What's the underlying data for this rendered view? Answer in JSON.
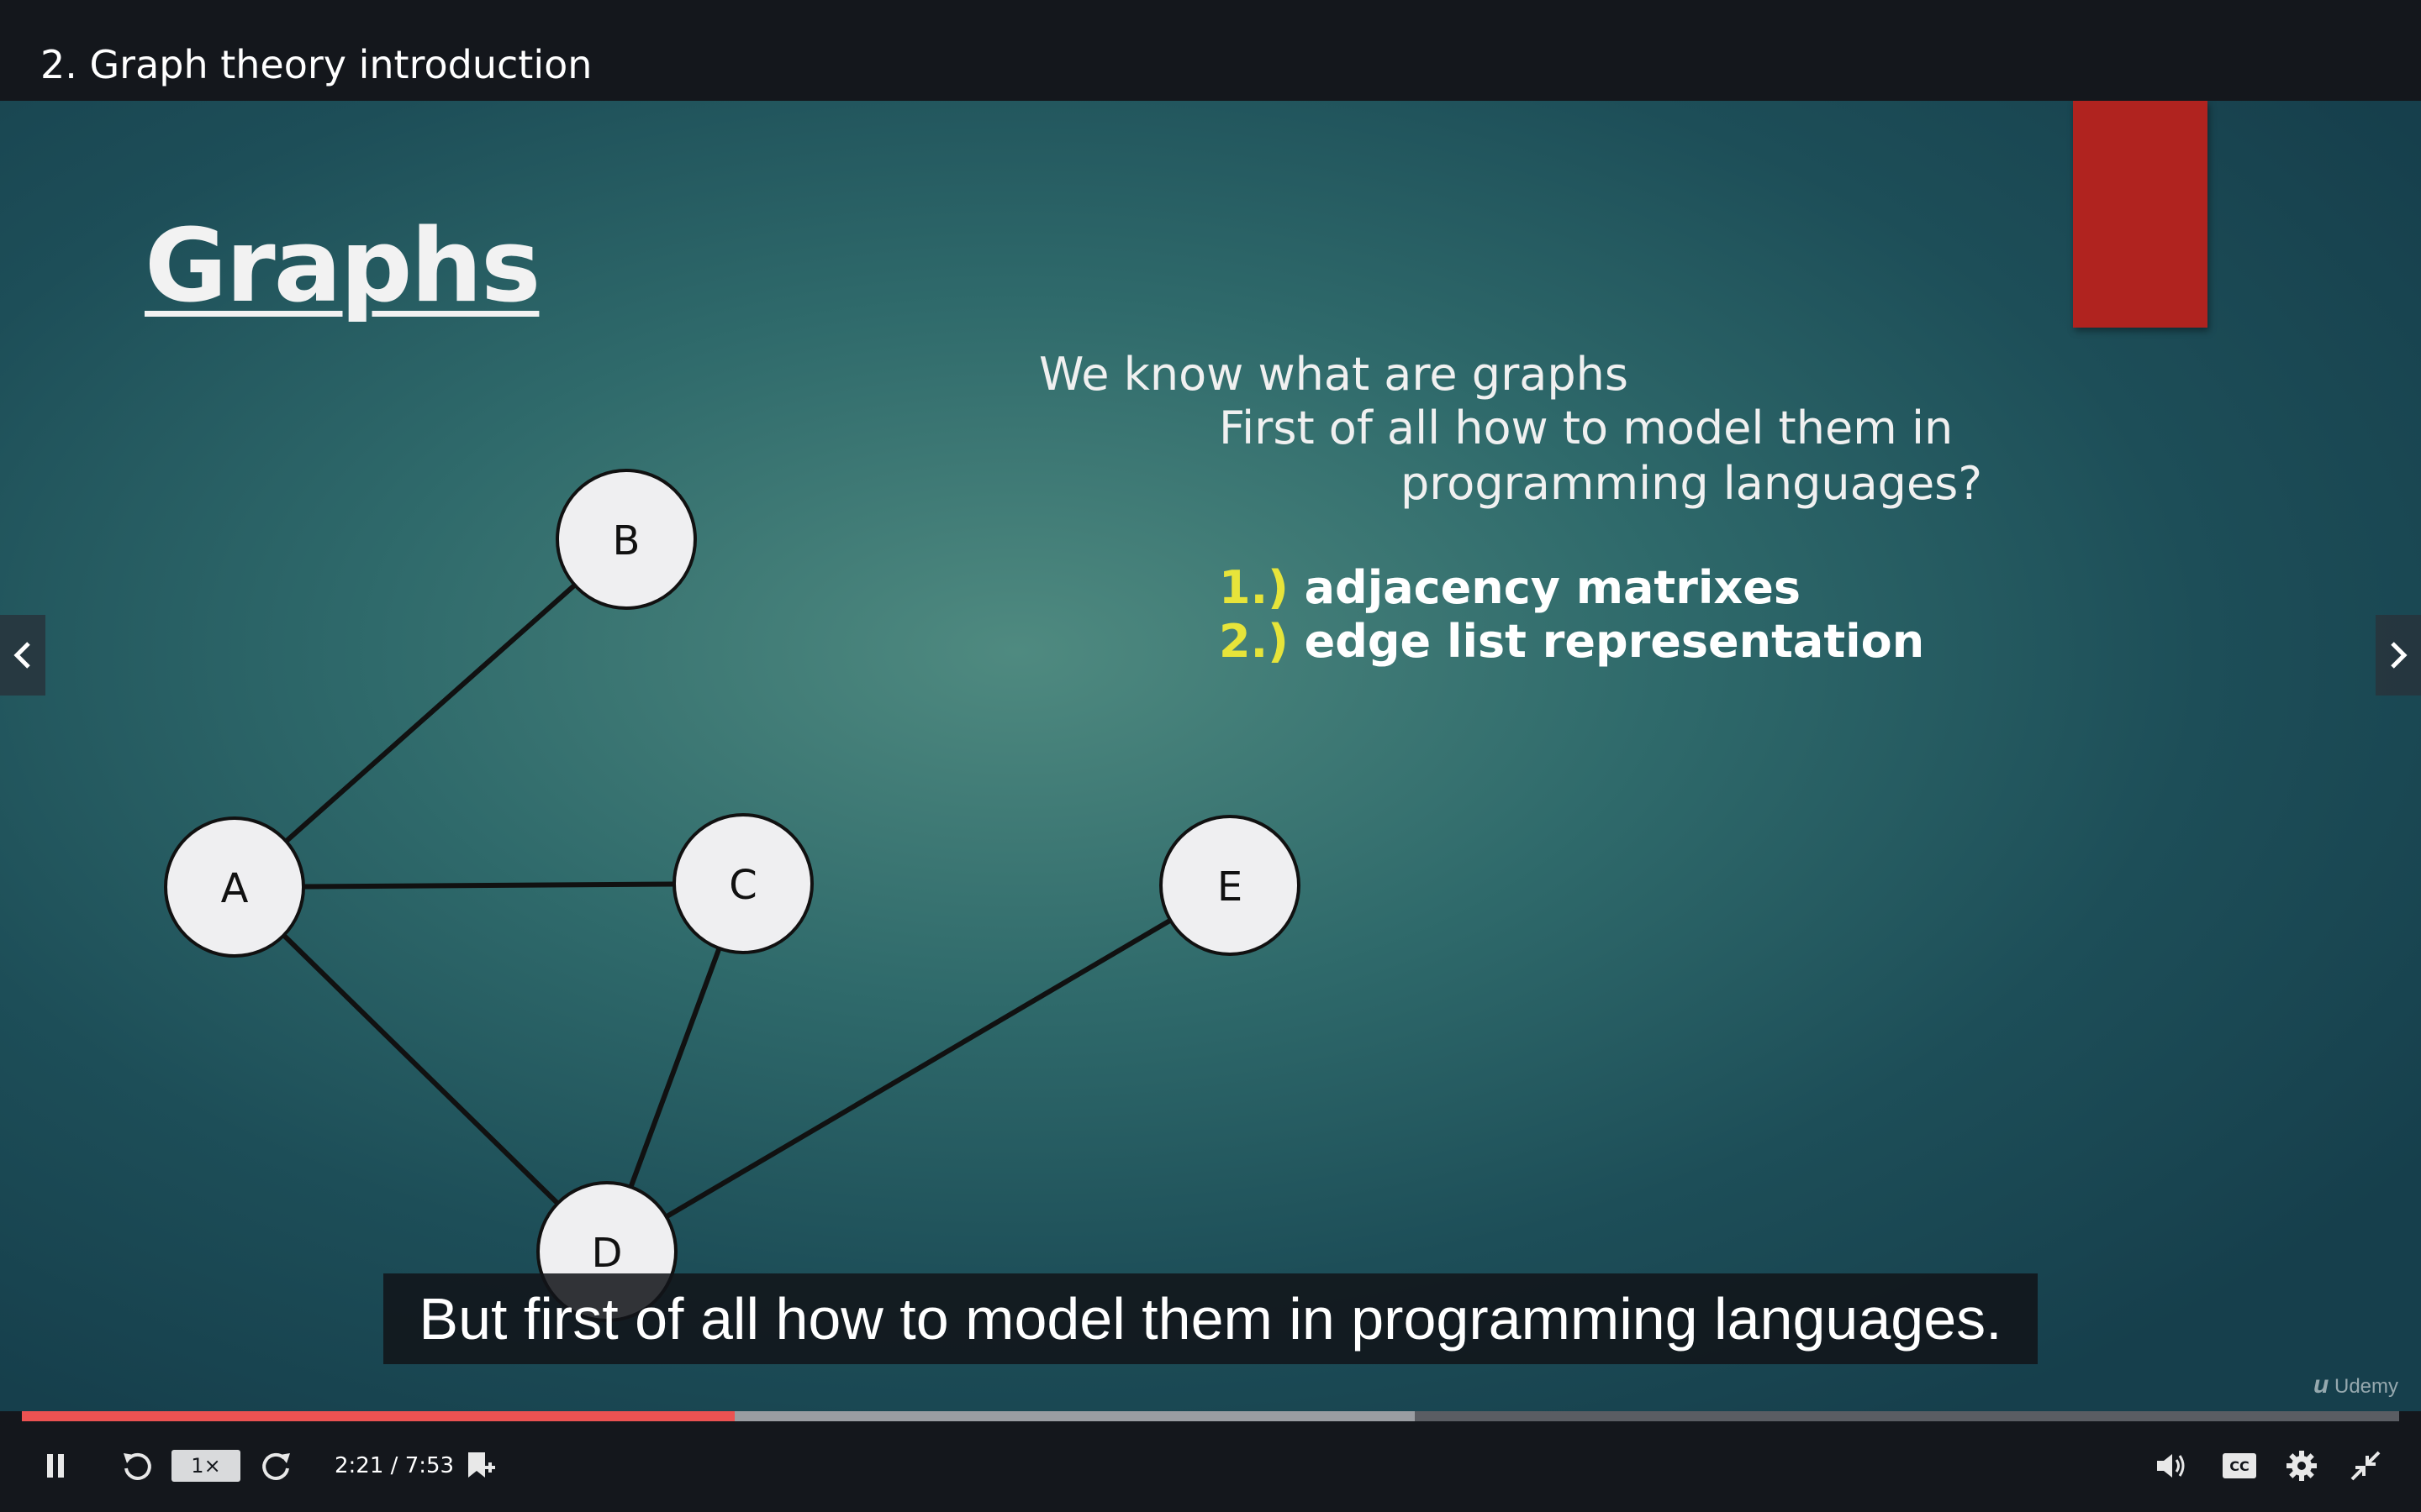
{
  "header": {
    "title": "2. Graph theory introduction"
  },
  "slide": {
    "title": "Graphs",
    "lines": [
      "We know what are graphs",
      "First of all how to model them in",
      "programming languages?"
    ],
    "list": [
      {
        "num": "1.)",
        "text": "adjacency matrixes"
      },
      {
        "num": "2.)",
        "text": "edge list representation"
      }
    ],
    "graph": {
      "nodes": [
        "A",
        "B",
        "C",
        "D",
        "E"
      ],
      "edges": [
        [
          "A",
          "B"
        ],
        [
          "A",
          "C"
        ],
        [
          "A",
          "D"
        ],
        [
          "C",
          "D"
        ],
        [
          "D",
          "E"
        ]
      ]
    }
  },
  "caption": {
    "text": "But first of all how to model them in programming languages."
  },
  "watermark": {
    "text": "Udemy"
  },
  "player": {
    "progress_played_fraction": 0.3,
    "progress_buffered_fraction": 0.586,
    "speed_label": "1×",
    "time_current": "2:21",
    "time_separator": "/",
    "time_total": "7:53",
    "icons": {
      "pause": "pause-icon",
      "rewind": "rewind-icon",
      "forward": "forward-icon",
      "bookmark": "add-bookmark-icon",
      "volume": "volume-icon",
      "captions": "captions-icon",
      "settings": "settings-icon",
      "fullscreen": "exit-fullscreen-icon",
      "prev": "chevron-left-icon",
      "next": "chevron-right-icon"
    }
  },
  "colors": {
    "progress": "#ec5252",
    "accent_list_number": "#e7e43a",
    "red_tab": "#b0231f"
  }
}
